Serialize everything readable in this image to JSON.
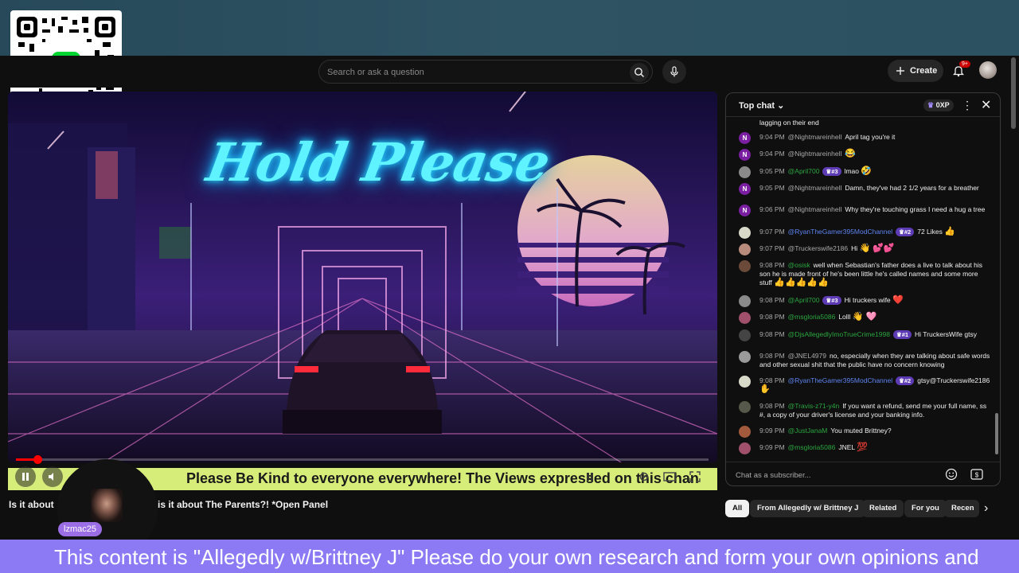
{
  "header": {
    "search_placeholder": "Search or ask a question",
    "create_label": "Create",
    "notifications_badge": "9+"
  },
  "video": {
    "overlay_title": "Hold Please",
    "progress_fraction": 0.03,
    "ticker_text": "Please Be Kind to everyone everywhere! The Views expressed on this chan",
    "title_left": "Is it about",
    "title_right": "is it about The Parents?! *Open Panel",
    "streamer_tag": "lzmac25"
  },
  "chat": {
    "title": "Top chat",
    "xp_label": "0XP",
    "input_placeholder": "Chat as a subscriber...",
    "messages": [
      {
        "avatar": "",
        "avatar_color": "#0f0f0f",
        "time": "",
        "user": "",
        "user_style": "plain",
        "rank": "",
        "text": "lagging on their end",
        "emoji": ""
      },
      {
        "avatar": "N",
        "avatar_color": "#7b1fa2",
        "time": "9:04 PM",
        "user": "@Nightmareinhell",
        "user_style": "plain",
        "rank": "",
        "text": "April tag you're it",
        "emoji": ""
      },
      {
        "avatar": "N",
        "avatar_color": "#7b1fa2",
        "time": "9:04 PM",
        "user": "@Nightmareinhell",
        "user_style": "plain",
        "rank": "",
        "text": "",
        "emoji": "😂"
      },
      {
        "avatar": "",
        "avatar_color": "#8a8a8a",
        "time": "9:05 PM",
        "user": "@April700",
        "user_style": "green",
        "rank": "#3",
        "text": "lmao",
        "emoji": "🤣"
      },
      {
        "avatar": "N",
        "avatar_color": "#7b1fa2",
        "time": "9:05 PM",
        "user": "@Nightmareinhell",
        "user_style": "plain",
        "rank": "",
        "text": "Damn, they've had 2 1/2 years for a breather",
        "emoji": ""
      },
      {
        "avatar": "N",
        "avatar_color": "#7b1fa2",
        "time": "9:06 PM",
        "user": "@Nightmareinhell",
        "user_style": "plain",
        "rank": "",
        "text": "Why they're touching grass I need a hug a tree",
        "emoji": ""
      },
      {
        "avatar": "",
        "avatar_color": "#d9d9c9",
        "time": "9:07 PM",
        "user": "@RyanTheGamer395ModChannel",
        "user_style": "blue",
        "rank": "#2",
        "text": "72 Likes",
        "emoji": "👍"
      },
      {
        "avatar": "",
        "avatar_color": "#b98b7c",
        "time": "9:07 PM",
        "user": "@Truckerswife2186",
        "user_style": "plain",
        "rank": "",
        "text": "Hi",
        "emoji": "👋 💕💕"
      },
      {
        "avatar": "",
        "avatar_color": "#6b4a3a",
        "time": "9:08 PM",
        "user": "@osisk",
        "user_style": "green",
        "rank": "",
        "text": "well when Sebastian's father does a live to talk about his son he is made front of he's been little he's called names and some more stuff",
        "emoji": "👍👍👍👍👍"
      },
      {
        "avatar": "",
        "avatar_color": "#8a8a8a",
        "time": "9:08 PM",
        "user": "@April700",
        "user_style": "green",
        "rank": "#3",
        "text": "Hi truckers wife",
        "emoji": "❤️"
      },
      {
        "avatar": "",
        "avatar_color": "#a0506a",
        "time": "9:08 PM",
        "user": "@msgloria5086",
        "user_style": "green",
        "rank": "",
        "text": "Lolll",
        "emoji": "👋 🩷"
      },
      {
        "avatar": "",
        "avatar_color": "#444444",
        "time": "9:08 PM",
        "user": "@DjsAllegedlyImoTrueCrime1998",
        "user_style": "green",
        "rank": "#1",
        "text": "Hi TruckersWife gtsy",
        "emoji": ""
      },
      {
        "avatar": "",
        "avatar_color": "#9a9a9a",
        "time": "9:08 PM",
        "user": "@JNEL4979",
        "user_style": "plain",
        "rank": "",
        "text": "no, especially when they are talking about safe words and other sexual shit that the public have no concern knowing",
        "emoji": ""
      },
      {
        "avatar": "",
        "avatar_color": "#d9d9c9",
        "time": "9:08 PM",
        "user": "@RyanTheGamer395ModChannel",
        "user_style": "blue",
        "rank": "#2",
        "text": "gtsy@Truckerswife2186",
        "emoji": "✋"
      },
      {
        "avatar": "",
        "avatar_color": "#55584a",
        "time": "9:08 PM",
        "user": "@Travis-z71-y4n",
        "user_style": "green",
        "rank": "",
        "text": "If you want a refund, send me your full name, ss #, a copy of your driver's license and your banking info.",
        "emoji": ""
      },
      {
        "avatar": "",
        "avatar_color": "#a35a3c",
        "time": "9:09 PM",
        "user": "@JustJanaM",
        "user_style": "green",
        "rank": "",
        "text": "You muted Brittney?",
        "emoji": ""
      },
      {
        "avatar": "",
        "avatar_color": "#a0506a",
        "time": "9:09 PM",
        "user": "@msgloria5086",
        "user_style": "green",
        "rank": "",
        "text": "JNEL",
        "emoji": "💯"
      }
    ]
  },
  "chips": [
    "All",
    "From Allegedly w/ Brittney J",
    "Related",
    "For you",
    "Recen"
  ],
  "bottom_ticker": "This content is \"Allegedly w/Brittney J\" Please do your own research and form your own opinions and",
  "colors": {
    "ticker_bg": "#d6ee79",
    "bottom_bg": "#8c7af5",
    "progress": "#ff0000",
    "neon_title": "#5ff3ff"
  }
}
